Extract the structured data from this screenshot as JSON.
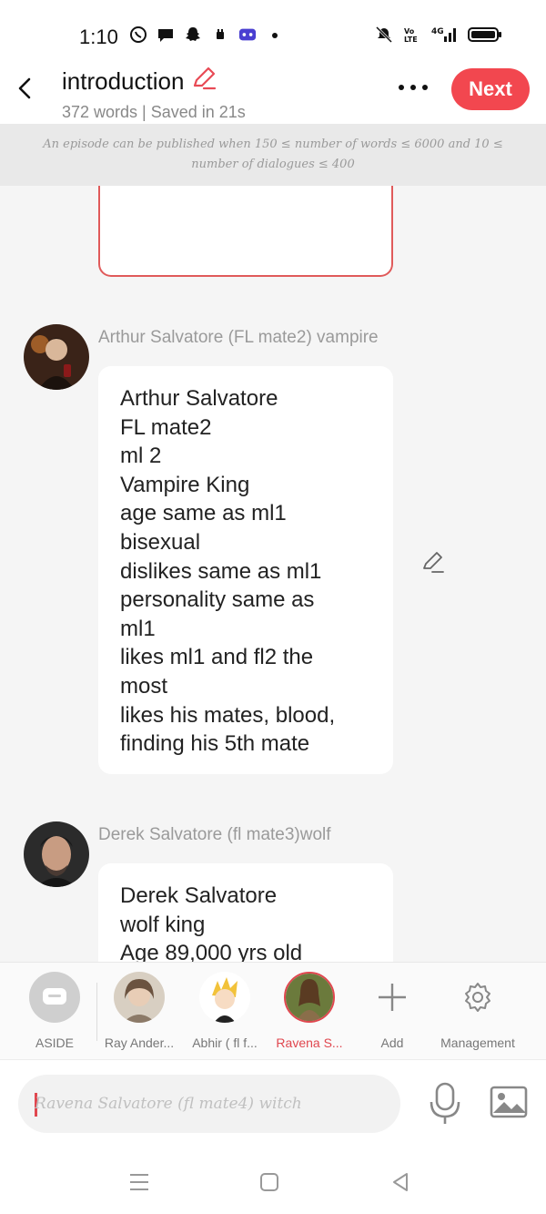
{
  "status_bar": {
    "time": "1:10",
    "left_icons": [
      "whatsapp-icon",
      "chat-icon",
      "snapchat-icon",
      "alarm-icon",
      "game-icon",
      "dot-icon"
    ],
    "right_icons": [
      "mute-icon",
      "volte-icon",
      "4g-signal-icon",
      "battery-icon"
    ]
  },
  "header": {
    "title": "introduction",
    "subtitle": "372 words | Saved in 21s",
    "next_label": "Next"
  },
  "notice": {
    "text": "An episode can be published when 150 ≤ number of words ≤ 6000 and 10 ≤ number of dialogues ≤ 400"
  },
  "messages": [
    {
      "speaker": "Arthur Salvatore (FL mate2) vampire",
      "lines": [
        "Arthur Salvatore",
        "FL mate2",
        "ml 2",
        "Vampire King",
        "age same as ml1",
        "bisexual",
        "dislikes same as ml1",
        "personality same as",
        "ml1",
        "likes ml1 and fl2 the",
        "most",
        "likes his mates, blood,",
        "finding his 5th mate"
      ]
    },
    {
      "speaker": "Derek Salvatore (fl mate3)wolf",
      "lines": [
        "Derek Salvatore",
        "wolf king",
        "Age 89,000 yrs old"
      ]
    }
  ],
  "characters": [
    {
      "label": "ASIDE"
    },
    {
      "label": "Ray Ander..."
    },
    {
      "label": "Abhir ( fl f..."
    },
    {
      "label": "Ravena S..."
    },
    {
      "label": "Add"
    },
    {
      "label": "Management"
    }
  ],
  "input": {
    "placeholder": "Ravena Salvatore (fl mate4) witch"
  },
  "colors": {
    "accent": "#f2474f",
    "notice_bg": "#e9e9e9",
    "background": "#f5f5f5"
  }
}
